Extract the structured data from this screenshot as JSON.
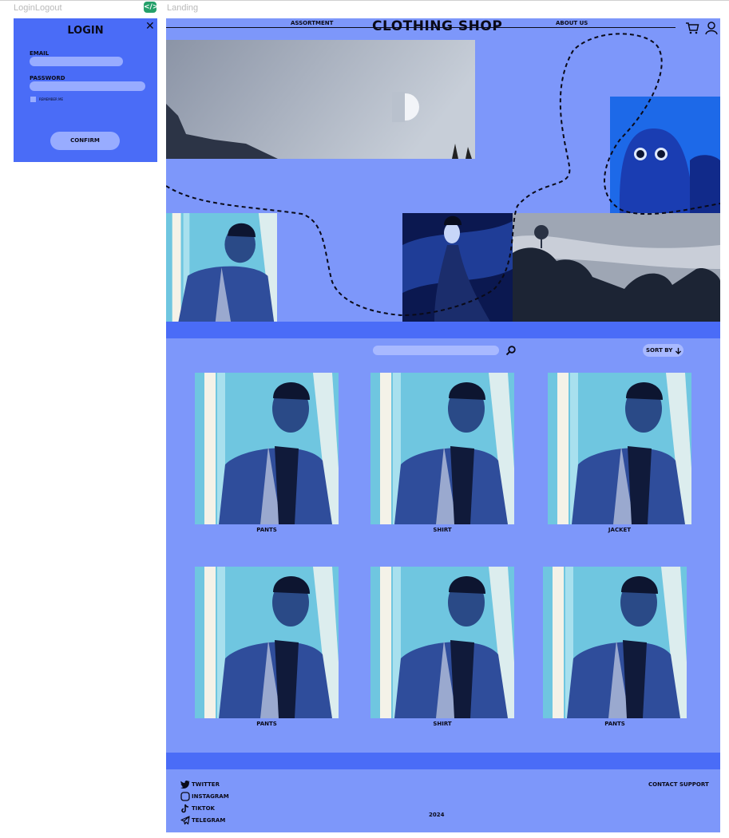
{
  "frames": {
    "left_label": "LoginLogout",
    "right_label": "Landing"
  },
  "login": {
    "title": "LOGIN",
    "email_label": "EMAIL",
    "password_label": "PASSWORD",
    "remember_label": "REMEMBER ME",
    "confirm_label": "CONFIRM"
  },
  "nav": {
    "assortment": "ASSORTMENT",
    "brand": "CLOTHING SHOP",
    "about": "ABOUT US",
    "cart_icon": "cart-icon",
    "user_icon": "user-icon"
  },
  "catalog": {
    "sort_label": "SORT BY",
    "products": [
      {
        "name": "PANTS"
      },
      {
        "name": "SHIRT"
      },
      {
        "name": "JACKET"
      },
      {
        "name": "PANTS"
      },
      {
        "name": "SHIRT"
      },
      {
        "name": "PANTS"
      }
    ]
  },
  "footer": {
    "socials": [
      {
        "label": "TWITTER",
        "icon": "twitter-icon"
      },
      {
        "label": "INSTAGRAM",
        "icon": "instagram-icon"
      },
      {
        "label": "TIKTOK",
        "icon": "tiktok-icon"
      },
      {
        "label": "TELEGRAM",
        "icon": "telegram-icon"
      }
    ],
    "contact": "CONTACT SUPPORT",
    "year": "2024"
  },
  "colors": {
    "landing_bg": "#7d97fa",
    "accent_blue": "#4a6cf7",
    "field": "#98acff",
    "text": "#0a0a18"
  }
}
